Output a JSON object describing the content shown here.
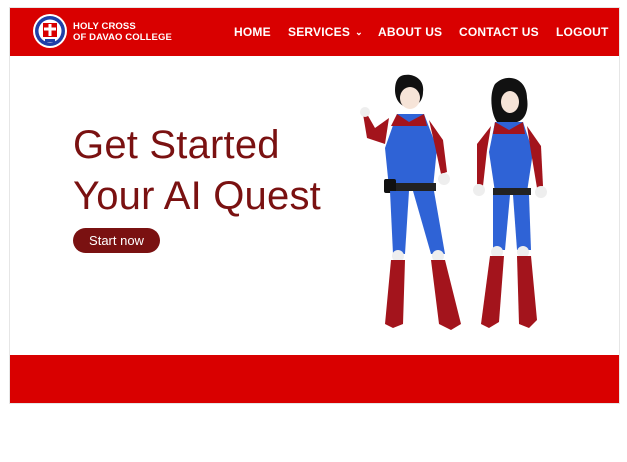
{
  "brand": {
    "line1": "HOLY CROSS",
    "line2": "OF DAVAO COLLEGE",
    "logo_icon": "college-seal-icon"
  },
  "nav": {
    "home": "HOME",
    "services": "SERVICES",
    "services_caret": "⌄",
    "about": "ABOUT US",
    "contact": "CONTACT US",
    "logout": "LOGOUT"
  },
  "hero": {
    "title_line1": "Get Started",
    "title_line2": "Your AI Quest",
    "cta_label": "Start now",
    "illustration": "two-superheroes-illustration"
  },
  "colors": {
    "brand_red": "#d90000",
    "maroon": "#7a1111",
    "blue": "#2f63d6"
  }
}
